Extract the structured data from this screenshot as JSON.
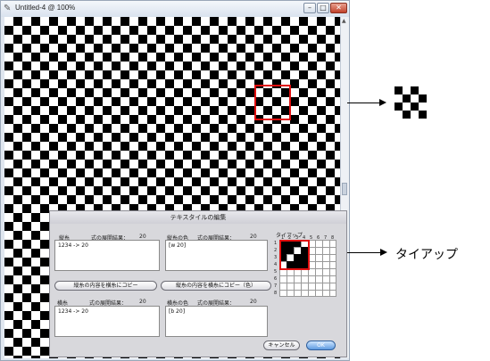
{
  "window": {
    "title": "Untitled-4 @ 100%",
    "app_icon": "pencil-icon",
    "minimize": "–",
    "maximize": "□",
    "close": "✕"
  },
  "annotation": {
    "tieup_label": "タイアップ"
  },
  "dialog": {
    "title": "テキスタイルの編集",
    "warp": {
      "label": "縦糸",
      "expand_label": "式の展開結果：",
      "expand_value": "20",
      "value": "1234 -> 20"
    },
    "warp_color": {
      "label": "縦糸の色",
      "expand_label": "式の展開結果：",
      "expand_value": "20",
      "value": "[w 20]"
    },
    "copy_warp_button": "縦糸の内容を横糸にコピー",
    "copy_warp_color_button": "縦糸の内容を横糸にコピー（色）",
    "weft": {
      "label": "横糸",
      "expand_label": "式の展開結果：",
      "expand_value": "20",
      "value": "1234 -> 20"
    },
    "weft_color": {
      "label": "横糸の色",
      "expand_label": "式の展開結果：",
      "expand_value": "20",
      "value": "[b 20]"
    },
    "tieup": {
      "label": "タイアップ",
      "col_numbers": [
        "1",
        "2",
        "3",
        "4",
        "5",
        "6",
        "7",
        "8"
      ],
      "row_numbers": [
        "1",
        "2",
        "3",
        "4",
        "5",
        "6",
        "7",
        "8"
      ],
      "filled": [
        [
          0,
          0
        ],
        [
          0,
          1
        ],
        [
          0,
          2
        ],
        [
          1,
          0
        ],
        [
          1,
          1
        ],
        [
          1,
          3
        ],
        [
          2,
          0
        ],
        [
          2,
          2
        ],
        [
          2,
          3
        ],
        [
          3,
          1
        ],
        [
          3,
          2
        ],
        [
          3,
          3
        ]
      ]
    },
    "cancel_button": "キャンセル",
    "ok_button": "OK"
  }
}
